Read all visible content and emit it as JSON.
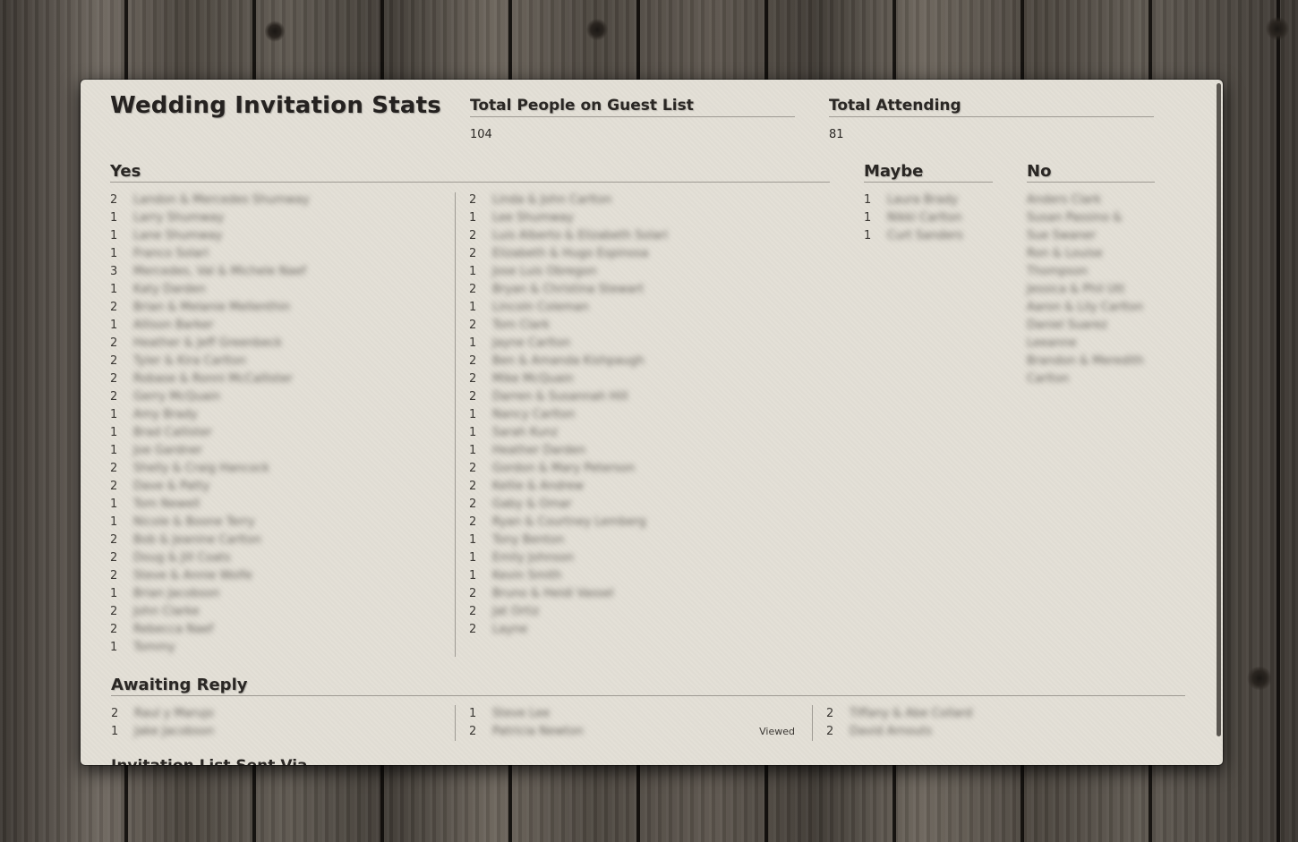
{
  "page": {
    "title": "Wedding Invitation Stats"
  },
  "stats": {
    "guest_list_label": "Total People on Guest List",
    "guest_list_value": "104",
    "attending_label": "Total Attending",
    "attending_value": "81"
  },
  "sections": {
    "yes": "Yes",
    "maybe": "Maybe",
    "no": "No",
    "awaiting": "Awaiting Reply",
    "cutoff": "Invitation List Sent Via"
  },
  "yes_col1": [
    {
      "count": "2",
      "name": "Landon & Mercedes Shumway"
    },
    {
      "count": "1",
      "name": "Larry Shumway"
    },
    {
      "count": "1",
      "name": "Lane Shumway"
    },
    {
      "count": "1",
      "name": "Franco Solari"
    },
    {
      "count": "3",
      "name": "Mercedes, Val & Michele Naef"
    },
    {
      "count": "1",
      "name": "Katy Darden"
    },
    {
      "count": "2",
      "name": "Brian & Melanie Mellenthin"
    },
    {
      "count": "1",
      "name": "Allison Barker"
    },
    {
      "count": "2",
      "name": "Heather & Jeff Greenbeck"
    },
    {
      "count": "2",
      "name": "Tyler & Kira Carlton"
    },
    {
      "count": "2",
      "name": "Robase & Ronni McCallister"
    },
    {
      "count": "2",
      "name": "Gerry McQuain"
    },
    {
      "count": "1",
      "name": "Amy Brady"
    },
    {
      "count": "1",
      "name": "Brad Callister"
    },
    {
      "count": "1",
      "name": "Joe Gardner"
    },
    {
      "count": "2",
      "name": "Shelly & Craig Hancock"
    },
    {
      "count": "2",
      "name": "Dave & Patty"
    },
    {
      "count": "1",
      "name": "Tom Newell"
    },
    {
      "count": "1",
      "name": "Nicole & Boone Terry"
    },
    {
      "count": "2",
      "name": "Bob & Jeanine Carlton"
    },
    {
      "count": "2",
      "name": "Doug & Jill Coats"
    },
    {
      "count": "2",
      "name": "Steve & Annie Wolfe"
    },
    {
      "count": "1",
      "name": "Brian Jacobson"
    },
    {
      "count": "2",
      "name": "John Clarke"
    },
    {
      "count": "2",
      "name": "Rebecca Naef"
    },
    {
      "count": "1",
      "name": "Tommy"
    }
  ],
  "yes_col2": [
    {
      "count": "2",
      "name": "Linda & John Carlton"
    },
    {
      "count": "1",
      "name": "Lee Shumway"
    },
    {
      "count": "2",
      "name": "Luis Alberto & Elizabeth Solari"
    },
    {
      "count": "2",
      "name": "Elizabeth & Hugo Espinosa"
    },
    {
      "count": "1",
      "name": "Jose Luis Obregon"
    },
    {
      "count": "2",
      "name": "Bryan & Christina Stewart"
    },
    {
      "count": "1",
      "name": "Lincoln Coleman"
    },
    {
      "count": "2",
      "name": "Tom Clark"
    },
    {
      "count": "1",
      "name": "Jayne Carlton"
    },
    {
      "count": "2",
      "name": "Ben & Amanda Kishpaugh"
    },
    {
      "count": "2",
      "name": "Mike McQuain"
    },
    {
      "count": "2",
      "name": "Darren & Susannah Hill"
    },
    {
      "count": "1",
      "name": "Nancy Carlton"
    },
    {
      "count": "1",
      "name": "Sarah Kunz"
    },
    {
      "count": "1",
      "name": "Heather Darden"
    },
    {
      "count": "2",
      "name": "Gordon & Mary Peterson"
    },
    {
      "count": "2",
      "name": "Kellie & Andrew"
    },
    {
      "count": "2",
      "name": "Gaby & Omar"
    },
    {
      "count": "2",
      "name": "Ryan & Courtney Lemberg"
    },
    {
      "count": "1",
      "name": "Tony Benton"
    },
    {
      "count": "1",
      "name": "Emily Johnson"
    },
    {
      "count": "1",
      "name": "Kevin Smith"
    },
    {
      "count": "2",
      "name": "Bruno & Heidi Vassel"
    },
    {
      "count": "2",
      "name": "Jat Ortiz"
    },
    {
      "count": "2",
      "name": "Layne"
    }
  ],
  "maybe": [
    {
      "count": "1",
      "name": "Laura Brady"
    },
    {
      "count": "1",
      "name": "Nikki Carlton"
    },
    {
      "count": "1",
      "name": "Curt Sanders"
    }
  ],
  "no": [
    "Anders Clark",
    "Susan Passino &",
    "Sue Swaner",
    "Ron & Louise",
    "Thompson",
    "Jessica & Phil Utt",
    "Aaron & Lily Carlton",
    "Daniel Suarez",
    "Leeanne",
    "Brandon & Meredith",
    "Carlton"
  ],
  "awaiting_col1": [
    {
      "count": "2",
      "name": "Raul y Marujo"
    },
    {
      "count": "1",
      "name": "Jake Jacobson"
    }
  ],
  "awaiting_col2": [
    {
      "count": "1",
      "name": "Steve Lee",
      "viewed": ""
    },
    {
      "count": "2",
      "name": "Patricia Newton",
      "viewed": "Viewed"
    }
  ],
  "awaiting_col3": [
    {
      "count": "2",
      "name": "Tiffany & Abe Collard"
    },
    {
      "count": "2",
      "name": "David Arnouts"
    }
  ]
}
